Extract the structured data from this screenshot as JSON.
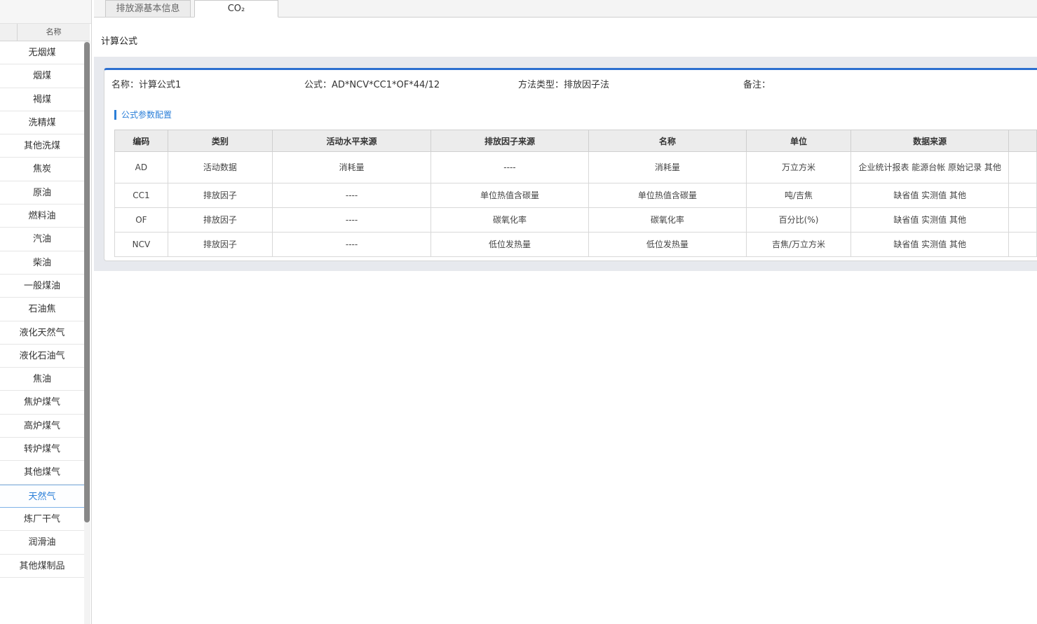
{
  "sidebar": {
    "column_title": "名称",
    "items": [
      "无烟煤",
      "烟煤",
      "褐煤",
      "洗精煤",
      "其他洗煤",
      "焦炭",
      "原油",
      "燃料油",
      "汽油",
      "柴油",
      "一般煤油",
      "石油焦",
      "液化天然气",
      "液化石油气",
      "焦油",
      "焦炉煤气",
      "高炉煤气",
      "转炉煤气",
      "其他煤气",
      "天然气",
      "炼厂干气",
      "润滑油",
      "其他煤制品"
    ],
    "active_item": "天然气"
  },
  "tabs": [
    {
      "label": "排放源基本信息"
    },
    {
      "label": "CO₂"
    }
  ],
  "main": {
    "section_title": "计算公式",
    "formula": {
      "name": "名称：计算公式1",
      "expression": "公式：AD*NCV*CC1*OF*44/12",
      "method": "方法类型：排放因子法",
      "remark": "备注："
    },
    "param_section_title": "公式参数配置",
    "table": {
      "headers": [
        "编码",
        "类别",
        "活动水平来源",
        "排放因子来源",
        "名称",
        "单位",
        "数据来源",
        ""
      ],
      "rows": [
        [
          "AD",
          "活动数据",
          "消耗量",
          "----",
          "消耗量",
          "万立方米",
          "企业统计报表 能源台帐 原始记录 其他",
          ""
        ],
        [
          "CC1",
          "排放因子",
          "----",
          "单位热值含碳量",
          "单位热值含碳量",
          "吨/吉焦",
          "缺省值 实测值 其他",
          ""
        ],
        [
          "OF",
          "排放因子",
          "----",
          "碳氧化率",
          "碳氧化率",
          "百分比(%)",
          "缺省值 实测值 其他",
          ""
        ],
        [
          "NCV",
          "排放因子",
          "----",
          "低位发热量",
          "低位发热量",
          "吉焦/万立方米",
          "缺省值 实测值 其他",
          ""
        ]
      ]
    }
  },
  "colors": {
    "accent": "#2b7fd8",
    "card_top_border": "#2c6fd0",
    "panel_bg": "#e7e9ee"
  }
}
